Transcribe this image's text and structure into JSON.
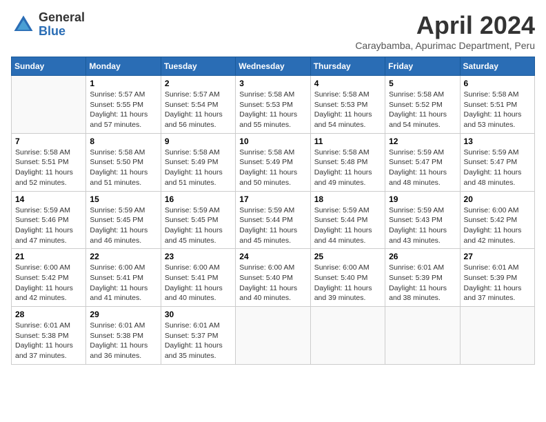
{
  "logo": {
    "general": "General",
    "blue": "Blue"
  },
  "title": "April 2024",
  "subtitle": "Caraybamba, Apurimac Department, Peru",
  "weekdays": [
    "Sunday",
    "Monday",
    "Tuesday",
    "Wednesday",
    "Thursday",
    "Friday",
    "Saturday"
  ],
  "weeks": [
    [
      {
        "day": "",
        "info": ""
      },
      {
        "day": "1",
        "info": "Sunrise: 5:57 AM\nSunset: 5:55 PM\nDaylight: 11 hours\nand 57 minutes."
      },
      {
        "day": "2",
        "info": "Sunrise: 5:57 AM\nSunset: 5:54 PM\nDaylight: 11 hours\nand 56 minutes."
      },
      {
        "day": "3",
        "info": "Sunrise: 5:58 AM\nSunset: 5:53 PM\nDaylight: 11 hours\nand 55 minutes."
      },
      {
        "day": "4",
        "info": "Sunrise: 5:58 AM\nSunset: 5:53 PM\nDaylight: 11 hours\nand 54 minutes."
      },
      {
        "day": "5",
        "info": "Sunrise: 5:58 AM\nSunset: 5:52 PM\nDaylight: 11 hours\nand 54 minutes."
      },
      {
        "day": "6",
        "info": "Sunrise: 5:58 AM\nSunset: 5:51 PM\nDaylight: 11 hours\nand 53 minutes."
      }
    ],
    [
      {
        "day": "7",
        "info": "Sunrise: 5:58 AM\nSunset: 5:51 PM\nDaylight: 11 hours\nand 52 minutes."
      },
      {
        "day": "8",
        "info": "Sunrise: 5:58 AM\nSunset: 5:50 PM\nDaylight: 11 hours\nand 51 minutes."
      },
      {
        "day": "9",
        "info": "Sunrise: 5:58 AM\nSunset: 5:49 PM\nDaylight: 11 hours\nand 51 minutes."
      },
      {
        "day": "10",
        "info": "Sunrise: 5:58 AM\nSunset: 5:49 PM\nDaylight: 11 hours\nand 50 minutes."
      },
      {
        "day": "11",
        "info": "Sunrise: 5:58 AM\nSunset: 5:48 PM\nDaylight: 11 hours\nand 49 minutes."
      },
      {
        "day": "12",
        "info": "Sunrise: 5:59 AM\nSunset: 5:47 PM\nDaylight: 11 hours\nand 48 minutes."
      },
      {
        "day": "13",
        "info": "Sunrise: 5:59 AM\nSunset: 5:47 PM\nDaylight: 11 hours\nand 48 minutes."
      }
    ],
    [
      {
        "day": "14",
        "info": "Sunrise: 5:59 AM\nSunset: 5:46 PM\nDaylight: 11 hours\nand 47 minutes."
      },
      {
        "day": "15",
        "info": "Sunrise: 5:59 AM\nSunset: 5:45 PM\nDaylight: 11 hours\nand 46 minutes."
      },
      {
        "day": "16",
        "info": "Sunrise: 5:59 AM\nSunset: 5:45 PM\nDaylight: 11 hours\nand 45 minutes."
      },
      {
        "day": "17",
        "info": "Sunrise: 5:59 AM\nSunset: 5:44 PM\nDaylight: 11 hours\nand 45 minutes."
      },
      {
        "day": "18",
        "info": "Sunrise: 5:59 AM\nSunset: 5:44 PM\nDaylight: 11 hours\nand 44 minutes."
      },
      {
        "day": "19",
        "info": "Sunrise: 5:59 AM\nSunset: 5:43 PM\nDaylight: 11 hours\nand 43 minutes."
      },
      {
        "day": "20",
        "info": "Sunrise: 6:00 AM\nSunset: 5:42 PM\nDaylight: 11 hours\nand 42 minutes."
      }
    ],
    [
      {
        "day": "21",
        "info": "Sunrise: 6:00 AM\nSunset: 5:42 PM\nDaylight: 11 hours\nand 42 minutes."
      },
      {
        "day": "22",
        "info": "Sunrise: 6:00 AM\nSunset: 5:41 PM\nDaylight: 11 hours\nand 41 minutes."
      },
      {
        "day": "23",
        "info": "Sunrise: 6:00 AM\nSunset: 5:41 PM\nDaylight: 11 hours\nand 40 minutes."
      },
      {
        "day": "24",
        "info": "Sunrise: 6:00 AM\nSunset: 5:40 PM\nDaylight: 11 hours\nand 40 minutes."
      },
      {
        "day": "25",
        "info": "Sunrise: 6:00 AM\nSunset: 5:40 PM\nDaylight: 11 hours\nand 39 minutes."
      },
      {
        "day": "26",
        "info": "Sunrise: 6:01 AM\nSunset: 5:39 PM\nDaylight: 11 hours\nand 38 minutes."
      },
      {
        "day": "27",
        "info": "Sunrise: 6:01 AM\nSunset: 5:39 PM\nDaylight: 11 hours\nand 37 minutes."
      }
    ],
    [
      {
        "day": "28",
        "info": "Sunrise: 6:01 AM\nSunset: 5:38 PM\nDaylight: 11 hours\nand 37 minutes."
      },
      {
        "day": "29",
        "info": "Sunrise: 6:01 AM\nSunset: 5:38 PM\nDaylight: 11 hours\nand 36 minutes."
      },
      {
        "day": "30",
        "info": "Sunrise: 6:01 AM\nSunset: 5:37 PM\nDaylight: 11 hours\nand 35 minutes."
      },
      {
        "day": "",
        "info": ""
      },
      {
        "day": "",
        "info": ""
      },
      {
        "day": "",
        "info": ""
      },
      {
        "day": "",
        "info": ""
      }
    ]
  ]
}
